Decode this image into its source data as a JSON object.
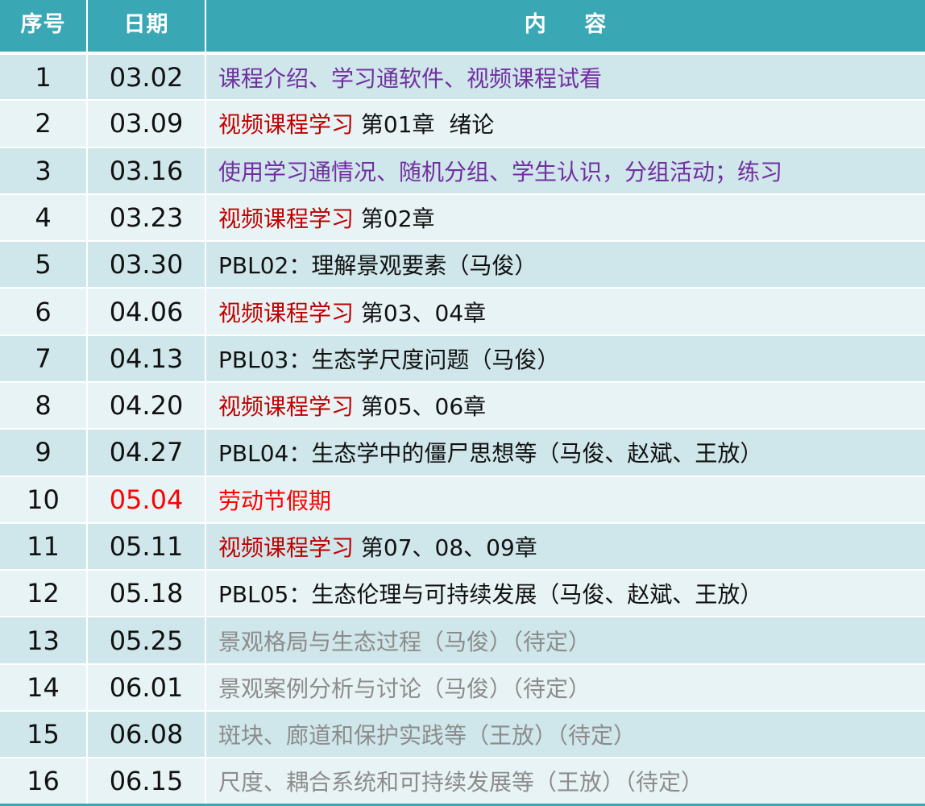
{
  "colors": {
    "header_bg": "#3aa8b4",
    "row_odd": "#cfe6ea",
    "row_even": "#e8f3f5",
    "purple": "#7030a0",
    "dark_red": "#c00000",
    "red": "#ff0000",
    "gray": "#8c8c8c",
    "black": "#111111"
  },
  "header": {
    "index": "序号",
    "date": "日期",
    "content": "内 容"
  },
  "rows": [
    {
      "index": "1",
      "date": "03.02",
      "date_color": "black",
      "parts": [
        {
          "text": "课程介绍、学习通软件、视频课程试看",
          "color": "purple"
        }
      ]
    },
    {
      "index": "2",
      "date": "03.09",
      "date_color": "black",
      "parts": [
        {
          "text": "视频课程学习",
          "color": "darkred"
        },
        {
          "text": " 第01章  绪论",
          "color": "black"
        }
      ]
    },
    {
      "index": "3",
      "date": "03.16",
      "date_color": "black",
      "parts": [
        {
          "text": "使用学习通情况、随机分组、学生认识，分组活动；练习",
          "color": "purple"
        }
      ]
    },
    {
      "index": "4",
      "date": "03.23",
      "date_color": "black",
      "parts": [
        {
          "text": "视频课程学习",
          "color": "darkred"
        },
        {
          "text": " 第02章",
          "color": "black"
        }
      ]
    },
    {
      "index": "5",
      "date": "03.30",
      "date_color": "black",
      "parts": [
        {
          "text": "PBL02：理解景观要素（马俊）",
          "color": "black"
        }
      ]
    },
    {
      "index": "6",
      "date": "04.06",
      "date_color": "black",
      "parts": [
        {
          "text": "视频课程学习",
          "color": "darkred"
        },
        {
          "text": " 第03、04章",
          "color": "black"
        }
      ]
    },
    {
      "index": "7",
      "date": "04.13",
      "date_color": "black",
      "parts": [
        {
          "text": "PBL03：生态学尺度问题（马俊）",
          "color": "black"
        }
      ]
    },
    {
      "index": "8",
      "date": "04.20",
      "date_color": "black",
      "parts": [
        {
          "text": "视频课程学习",
          "color": "darkred"
        },
        {
          "text": " 第05、06章",
          "color": "black"
        }
      ]
    },
    {
      "index": "9",
      "date": "04.27",
      "date_color": "black",
      "parts": [
        {
          "text": "PBL04：生态学中的僵尸思想等（马俊、赵斌、王放）",
          "color": "black"
        }
      ]
    },
    {
      "index": "10",
      "date": "05.04",
      "date_color": "red",
      "parts": [
        {
          "text": "劳动节假期",
          "color": "red"
        }
      ]
    },
    {
      "index": "11",
      "date": "05.11",
      "date_color": "black",
      "parts": [
        {
          "text": "视频课程学习",
          "color": "darkred"
        },
        {
          "text": " 第07、08、09章",
          "color": "black"
        }
      ]
    },
    {
      "index": "12",
      "date": "05.18",
      "date_color": "black",
      "parts": [
        {
          "text": "PBL05：生态伦理与可持续发展（马俊、赵斌、王放）",
          "color": "black"
        }
      ]
    },
    {
      "index": "13",
      "date": "05.25",
      "date_color": "black",
      "parts": [
        {
          "text": "景观格局与生态过程（马俊）（待定）",
          "color": "gray"
        }
      ]
    },
    {
      "index": "14",
      "date": "06.01",
      "date_color": "black",
      "parts": [
        {
          "text": "景观案例分析与讨论（马俊）（待定）",
          "color": "gray"
        }
      ]
    },
    {
      "index": "15",
      "date": "06.08",
      "date_color": "black",
      "parts": [
        {
          "text": "斑块、廊道和保护实践等（王放）（待定）",
          "color": "gray"
        }
      ]
    },
    {
      "index": "16",
      "date": "06.15",
      "date_color": "black",
      "parts": [
        {
          "text": "尺度、耦合系统和可持续发展等（王放）（待定）",
          "color": "gray"
        }
      ]
    }
  ]
}
